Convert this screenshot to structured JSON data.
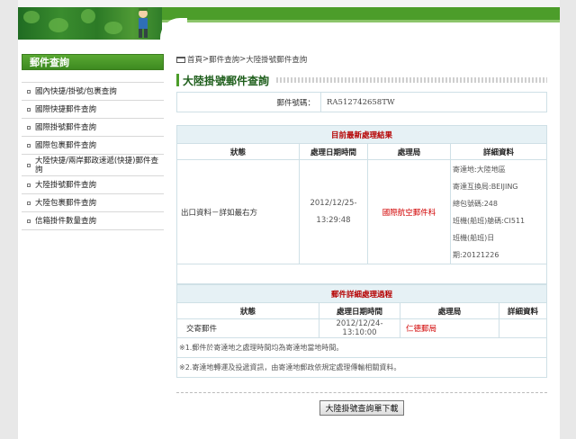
{
  "breadcrumb": [
    "首頁",
    "郵件查詢",
    "大陸掛號郵件查詢"
  ],
  "page_title": "大陸掛號郵件查詢",
  "sidebar": {
    "title": "郵件查詢",
    "items": [
      {
        "label": "國內快捷/掛號/包裹查詢"
      },
      {
        "label": "國際快捷郵件查詢"
      },
      {
        "label": "國際掛號郵件查詢"
      },
      {
        "label": "國際包裹郵件查詢"
      },
      {
        "label": "大陸快捷/兩岸郵政速遞(快捷)郵件查詢"
      },
      {
        "label": "大陸掛號郵件查詢"
      },
      {
        "label": "大陸包裹郵件查詢"
      },
      {
        "label": "信箱掛件數量查詢"
      }
    ]
  },
  "mail_number": {
    "label": "郵件號碼：",
    "value": "RA512742658TW"
  },
  "latest": {
    "section_title": "目前最新處理結果",
    "headers": [
      "狀態",
      "處理日期時間",
      "處理局",
      "詳細資料"
    ],
    "row": {
      "status": "出口資料－詳如最右方",
      "date": "2012/12/25-",
      "time": "13:29:48",
      "office": "國際航空郵件科",
      "details": [
        "寄達地:大陸地區",
        "寄達互換局:BEIJING",
        "總包號碼:248",
        "班機(船班)艙碼:CI511",
        "班機(船班)日",
        "期:20121226"
      ]
    }
  },
  "history": {
    "section_title": "郵件詳細處理過程",
    "headers": [
      "狀態",
      "處理日期時間",
      "處理局",
      "詳細資料"
    ],
    "rows": [
      {
        "status": "交寄郵件",
        "datetime": "2012/12/24-13:10:00",
        "office": "仁德郵局",
        "detail": ""
      }
    ],
    "notes": [
      "※1.郵件於寄達地之處理時間均為寄達地當地時間。",
      "※2.寄達地轉運及投遞資訊，由寄達地郵政依規定處理傳輸相關資料。"
    ]
  },
  "download_button": "大陸掛號查詢單下載",
  "colors": {
    "brand_green": "#4c9d2a",
    "accent_red": "#d10000",
    "section_bg": "#e6f1f5"
  }
}
